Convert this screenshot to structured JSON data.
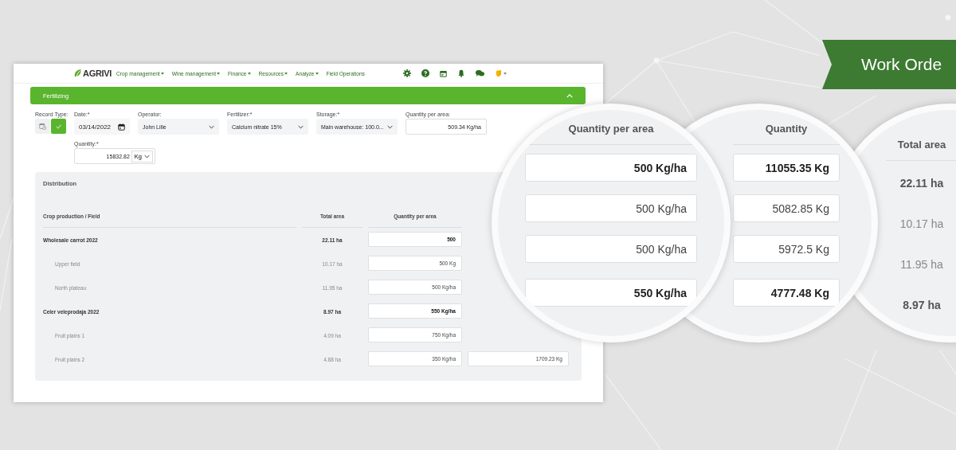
{
  "banner": {
    "title": "Work Orde"
  },
  "app": {
    "nav": {
      "logo": "AGRIVI",
      "menu": [
        {
          "label": "Crop management",
          "dropdown": true
        },
        {
          "label": "Wine management",
          "dropdown": true
        },
        {
          "label": "Finance",
          "dropdown": true
        },
        {
          "label": "Resources",
          "dropdown": true
        },
        {
          "label": "Analyze",
          "dropdown": true
        },
        {
          "label": "Field Operations",
          "dropdown": false
        }
      ],
      "icons": [
        {
          "kind": "settings"
        },
        {
          "kind": "help"
        },
        {
          "kind": "calendar"
        },
        {
          "kind": "bell"
        },
        {
          "kind": "chat"
        },
        {
          "kind": "avatar"
        }
      ]
    },
    "panel": {
      "title": "Fertilizing",
      "expanded": true,
      "record_type": {
        "label": "Record Type:",
        "options": [
          {
            "kind": "planned",
            "selected": false
          },
          {
            "kind": "done",
            "selected": true
          }
        ]
      },
      "fields": [
        {
          "label": "Date:*",
          "value": "03/14/2022",
          "kind": "date"
        },
        {
          "label": "Operator:",
          "value": "John Lille",
          "kind": "select"
        },
        {
          "label": "Fertilizer:*",
          "value": "Calcium nitrate 15%",
          "kind": "select"
        },
        {
          "label": "Storage:*",
          "value": "Main warehouse: 100.0...",
          "kind": "select"
        },
        {
          "label": "Quantity per area:",
          "value": "509.34 Kg/ha",
          "kind": "number"
        }
      ],
      "quantity": {
        "label": "Quantity:*",
        "value": "15832.82",
        "unit": "Kg"
      },
      "distribution": {
        "title": "Distribution",
        "columns": [
          "Crop production / Field",
          "Total area",
          "Quantity per area"
        ],
        "rows": [
          {
            "name": "Wholesale carrot 2022",
            "total_area": "22.11 ha",
            "quantity_per_area": "500",
            "children": [
              {
                "name": "Upper field",
                "total_area": "10.17 ha",
                "quantity_per_area": "500 Kg"
              },
              {
                "name": "North plateau",
                "total_area": "11.95 ha",
                "quantity_per_area": "500 Kg/ha"
              }
            ]
          },
          {
            "name": "Celer veleprodaja 2022",
            "total_area": "8.97 ha",
            "quantity_per_area": "550 Kg/ha",
            "children": [
              {
                "name": "Fruit plains 1",
                "total_area": "4.09 ha",
                "quantity_per_area": "750 Kg/ha"
              },
              {
                "name": "Fruit plains 2",
                "total_area": "4.88 ha",
                "quantity_per_area": "350 Kg/ha",
                "quantity": "1709.23 Kg"
              }
            ]
          }
        ]
      }
    }
  },
  "magnifiers": [
    {
      "kind": "fields",
      "heading": "Quantity per area",
      "values": [
        {
          "text": "500 Kg/ha",
          "bold": true
        },
        {
          "text": "500 Kg/ha",
          "bold": false
        },
        {
          "text": "500 Kg/ha",
          "bold": false
        },
        {
          "text": "550 Kg/ha",
          "bold": true
        }
      ]
    },
    {
      "kind": "fields",
      "heading": "Quantity",
      "values": [
        {
          "text": "11055.35 Kg",
          "bold": true
        },
        {
          "text": "5082.85 Kg",
          "bold": false
        },
        {
          "text": "5972.5 Kg",
          "bold": false
        },
        {
          "text": "4777.48 Kg",
          "bold": true
        }
      ]
    },
    {
      "kind": "text",
      "heading": "Total area",
      "values": [
        {
          "text": "22.11 ha",
          "bold": true
        },
        {
          "text": "10.17 ha",
          "bold": false
        },
        {
          "text": "11.95 ha",
          "bold": false
        },
        {
          "text": "8.97 ha",
          "bold": true
        }
      ]
    }
  ]
}
